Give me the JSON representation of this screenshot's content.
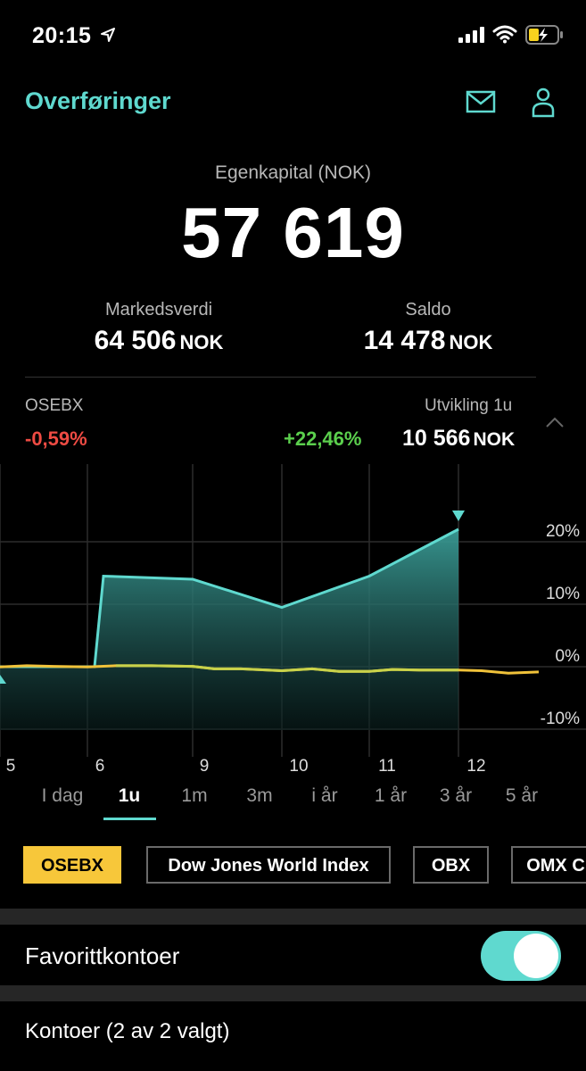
{
  "status": {
    "time": "20:15"
  },
  "header": {
    "title": "Overføringer"
  },
  "equity": {
    "label": "Egenkapital (NOK)",
    "value": "57 619"
  },
  "market_value": {
    "label": "Markedsverdi",
    "value": "64 506",
    "unit": "NOK"
  },
  "balance": {
    "label": "Saldo",
    "value": "14 478",
    "unit": "NOK"
  },
  "index": {
    "name": "OSEBX",
    "change": "-0,59%"
  },
  "development": {
    "label": "Utvikling  1u",
    "change": "+22,46%",
    "value": "10 566",
    "unit": "NOK"
  },
  "chart_data": {
    "type": "area",
    "x_ticks": [
      "5",
      "6",
      "9",
      "10",
      "11",
      "12"
    ],
    "y_ticks": [
      "20%",
      "10%",
      "0%",
      "-10%"
    ],
    "ylim": [
      -12,
      26
    ],
    "grid": true,
    "series": [
      {
        "color": "#5fd9cf",
        "points": [
          [
            4.5,
            0
          ],
          [
            5.1,
            0
          ],
          [
            5.9,
            0
          ],
          [
            6.0,
            14.5
          ],
          [
            6.9,
            14.0
          ],
          [
            7.9,
            9.5
          ],
          [
            8.9,
            14.5
          ],
          [
            9.9,
            22.5
          ]
        ]
      },
      {
        "color": "#c8d24a",
        "points": [
          [
            4.5,
            0
          ],
          [
            5.0,
            0.2
          ],
          [
            6.2,
            0.3
          ],
          [
            7.0,
            0.1
          ],
          [
            8.0,
            -0.4
          ],
          [
            9.0,
            -0.3
          ],
          [
            10.0,
            -0.6
          ],
          [
            10.9,
            -0.7
          ]
        ]
      }
    ]
  },
  "periods": [
    "I dag",
    "1u",
    "1m",
    "3m",
    "i år",
    "1 år",
    "3 år",
    "5 år"
  ],
  "active_period": "1u",
  "chips": [
    "OSEBX",
    "Dow Jones World Index",
    "OBX",
    "OMX C"
  ],
  "favorites": {
    "label": "Favorittkontoer",
    "enabled": true
  },
  "accounts": {
    "label": "Kontoer (2 av 2 valgt)"
  },
  "colors": {
    "accent": "#5fd9cf",
    "negative": "#ee4b43",
    "positive": "#5bcf4d",
    "chip_active": "#f7c73a"
  }
}
